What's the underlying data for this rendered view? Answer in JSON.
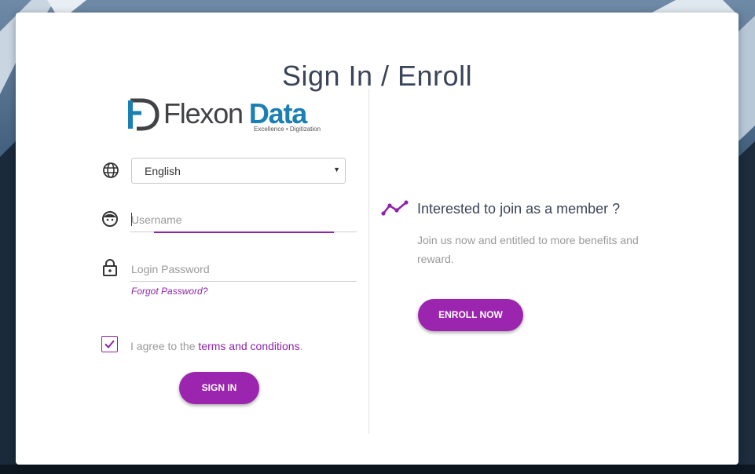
{
  "page": {
    "title": "Sign In / Enroll"
  },
  "logo": {
    "brand_part1": "Flexon",
    "brand_part2": "Data",
    "tagline": "Excellence • Digitization"
  },
  "login": {
    "language": {
      "selected": "English",
      "icon": "globe-icon"
    },
    "username": {
      "placeholder": "Username",
      "icon": "user-face-icon"
    },
    "password": {
      "placeholder": "Login Password",
      "icon": "lock-icon"
    },
    "forgot_label": "Forgot Password?",
    "agree_prefix": "I agree to the ",
    "terms_label": "terms and conditions",
    "agree_suffix": ".",
    "agree_checked": true,
    "signin_label": "SIGN IN"
  },
  "enroll": {
    "heading": "Interested to join as a member ?",
    "description": "Join us now and entitled to more benefits and reward.",
    "button_label": "ENROLL NOW",
    "icon": "trend-line-icon"
  },
  "colors": {
    "accent": "#9b25ae",
    "brand_blue": "#1a7fb3",
    "brand_gray": "#404246",
    "title": "#3b4458"
  }
}
